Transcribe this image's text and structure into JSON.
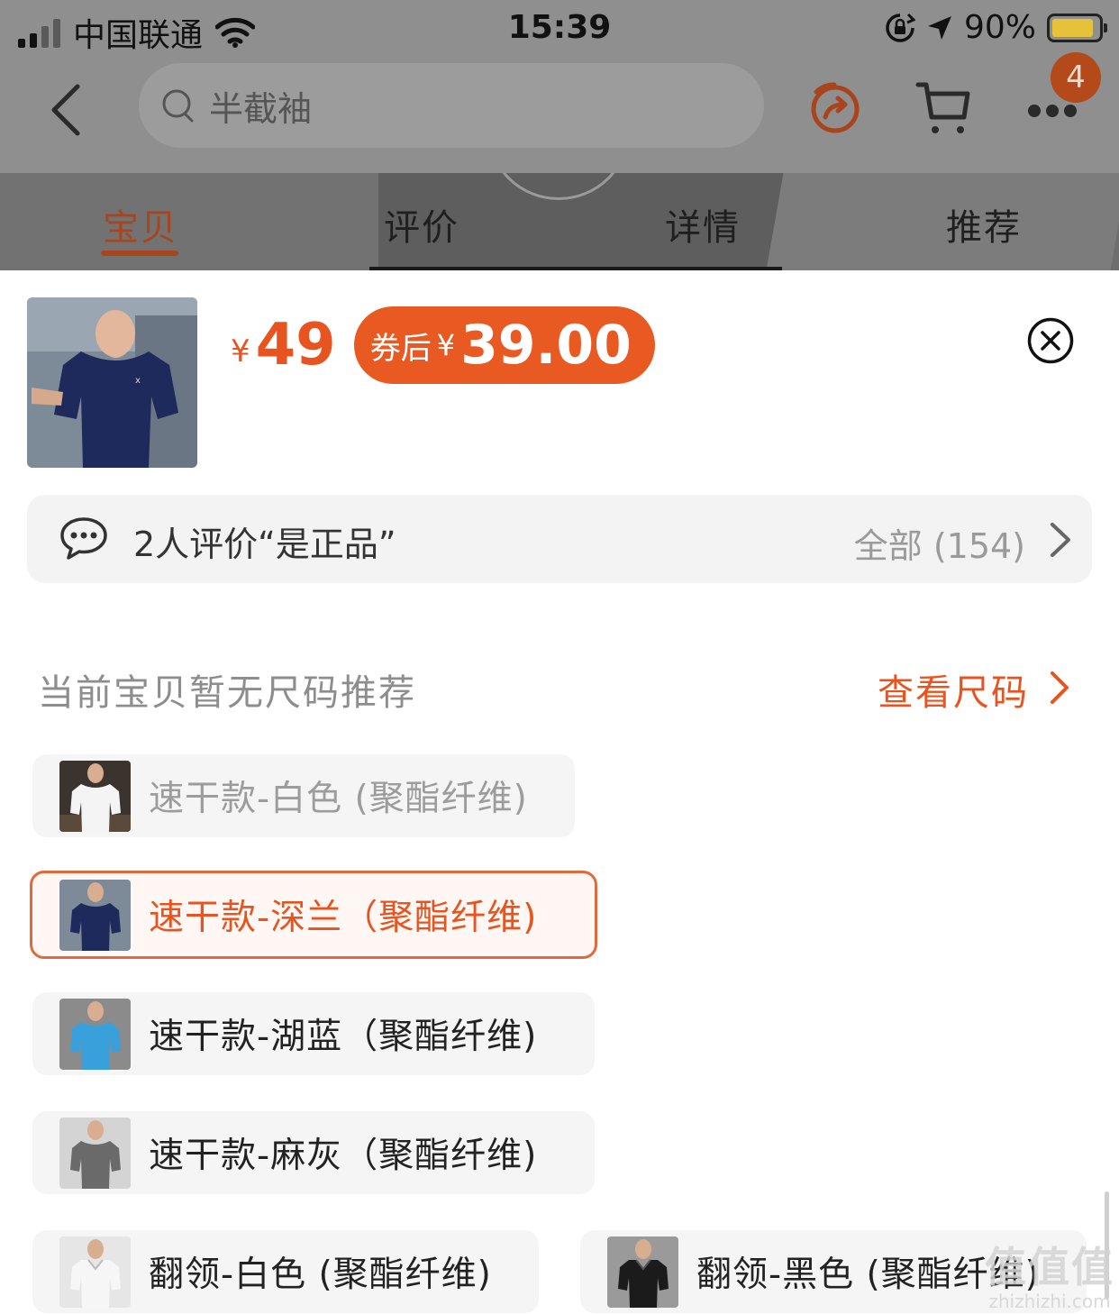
{
  "status_bar": {
    "carrier": "中国联通",
    "time": "15:39",
    "battery_percent": "90%",
    "battery_level": 0.9,
    "battery_color": "#e5c239"
  },
  "nav": {
    "search_placeholder": "半截袖",
    "back_icon": "chevron-left-icon",
    "share_icon": "share-icon",
    "cart_icon": "cart-icon",
    "more_icon": "more-dots-icon",
    "badge_count": "4"
  },
  "tabs": [
    {
      "label": "宝贝",
      "active": true
    },
    {
      "label": "评价",
      "active": false
    },
    {
      "label": "详情",
      "active": false
    },
    {
      "label": "推荐",
      "active": false
    }
  ],
  "product": {
    "currency_symbol": "¥",
    "price": "49",
    "coupon_label": "券后",
    "coupon_currency": "¥",
    "coupon_price": "39.00",
    "accent_color": "#e8541f"
  },
  "review": {
    "summary": "2人评价“是正品”",
    "all_label": "全部 (154)"
  },
  "size": {
    "hint": "当前宝贝暂无尺码推荐",
    "link": "查看尺码"
  },
  "options": [
    {
      "label": "速干款-白色 (聚酯纤维)",
      "state": "disabled",
      "shirt_color": "#f4f4f4"
    },
    {
      "label": "速干款-深兰（聚酯纤维)",
      "state": "selected",
      "shirt_color": "#1f2a5c"
    },
    {
      "label": "速干款-湖蓝（聚酯纤维)",
      "state": "normal",
      "shirt_color": "#3aa0dc"
    },
    {
      "label": "速干款-麻灰（聚酯纤维)",
      "state": "normal",
      "shirt_color": "#6a6a6a"
    },
    {
      "label": "翻领-白色 (聚酯纤维)",
      "state": "normal",
      "shirt_color": "#f6f6f6"
    },
    {
      "label": "翻领-黑色 (聚酯纤维)",
      "state": "normal",
      "shirt_color": "#1b1b1b"
    }
  ],
  "watermark": {
    "big": "值值值",
    "small": "zhizhizhi.com"
  }
}
